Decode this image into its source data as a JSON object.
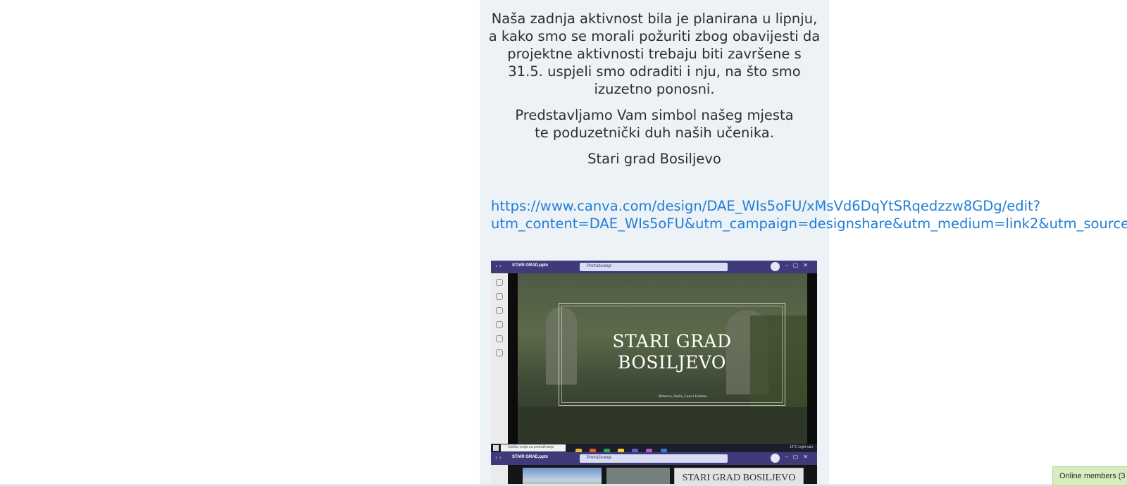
{
  "post": {
    "paragraph1": "Naša zadnja aktivnost bila je planirana u lipnju, a kako smo se morali požuriti zbog obavijesti da projektne aktivnosti trebaju biti završene s 31.5. uspjeli smo odraditi i nju, na što smo izuzetno ponosni.",
    "paragraph2": "Predstavljamo Vam simbol našeg mjesta te poduzetnički duh naših učenika.",
    "paragraph3": "Stari grad Bosiljevo",
    "link_line1": "https://www.canva.com/design/DAE_WIs5oFU/xMsVd6DqYtSRqedzzw8GDg/edit?",
    "link_line2": "utm_content=DAE_WIs5oFU&utm_campaign=designshare&utm_medium=link2&utm_source"
  },
  "screenshot": {
    "file_name": "STARI GRAD.pptx",
    "search_placeholder": "Pretraživanje",
    "slide_title_line1": "STARI GRAD",
    "slide_title_line2": "BOSILJEVO",
    "slide_subtitle": "Rebecca, Stella, Lana i Katrina",
    "taskbar_search": "Upišite ovdje za pretraživanje",
    "tray_text": "12°C  Light rain",
    "file_name_2": "STARI GRAD.pptx",
    "search_placeholder_2": "Pretraživanje",
    "thumbnail_title": "STARI GRAD BOSILJEVO"
  },
  "widget": {
    "online_members": "Online members (3"
  }
}
